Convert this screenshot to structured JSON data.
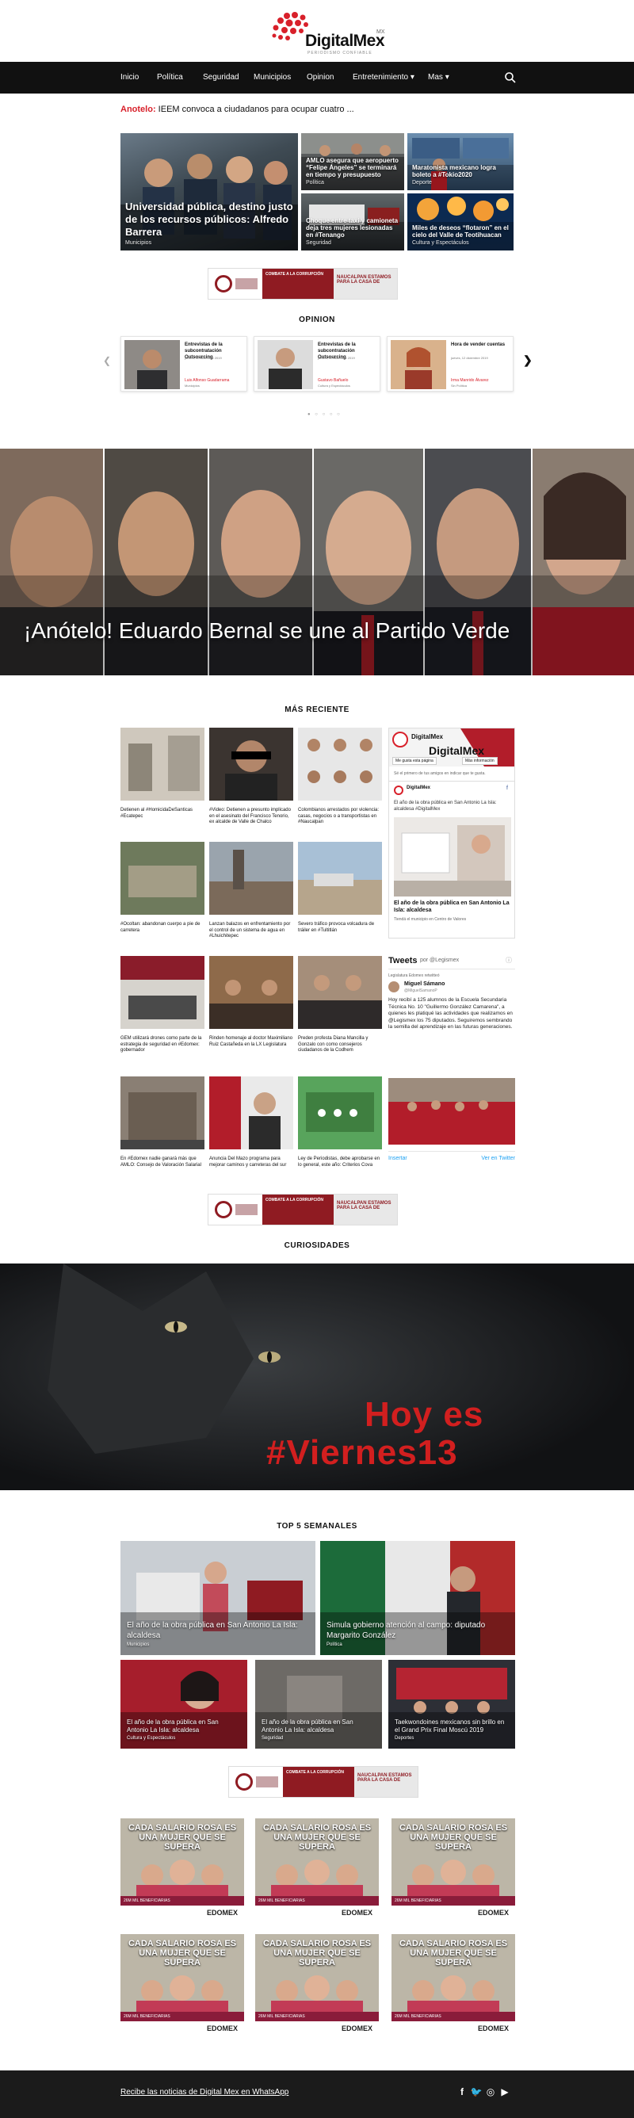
{
  "brand": {
    "name": "DigitalMex",
    "suffix": "MX",
    "tagline": "PERIODISMO CONFIABLE"
  },
  "nav": {
    "items": [
      "Inicio",
      "Política",
      "Seguridad",
      "Municipios",
      "Opinion",
      "Entretenimiento",
      "Mas"
    ]
  },
  "ticker": {
    "label": "Anotelo:",
    "text": "IEEM convoca a ciudadanos para ocupar cuatro ..."
  },
  "hero": {
    "main": {
      "title": "Universidad pública, destino justo de los recursos públicos: Alfredo Barrera",
      "category": "Municipios"
    },
    "tiles": [
      {
        "title": "AMLO asegura que aeropuerto “Felipe Ángeles” se terminará en tiempo y presupuesto",
        "category": "Política"
      },
      {
        "title": "Maratonista mexicano logra boleto a #Tokio2020",
        "category": "Deporte"
      },
      {
        "title": "Choque entre taxi y camioneta deja tres mujeres lesionadas en #Tenango",
        "category": "Seguridad"
      },
      {
        "title": "Miles de deseos “flotaron” en el cielo del Valle de Teotihuacan",
        "category": "Cultura y Espectáculos"
      }
    ]
  },
  "ad": {
    "text1": "COMBATE A LA CORRUPCIÓN",
    "text2": "NAUCALPAN ESTAMOS PARA LA CASA DE"
  },
  "sections": {
    "opinion": "OPINION",
    "recent": "MÁS RECIENTE",
    "curiosities": "CURIOSIDADES",
    "top5": "TOP 5 SEMANALES"
  },
  "opinion_cards": [
    {
      "title": "Entrevistas de la subcontratación Outsourcing",
      "date": "jueves, 12 diciembre 2019",
      "author": "Luis Alfonso Guadarrama",
      "category": "Municipios"
    },
    {
      "title": "Entrevistas de la subcontratación Outsourcing",
      "date": "jueves, 12 diciembre 2019",
      "author": "Gustavo Bañuelo",
      "category": "Cultura y Espectáculos"
    },
    {
      "title": "Hora de vender cuentas",
      "date": "jueves, 12 diciembre 2019",
      "author": "Irma Manrido Álvarez",
      "category": "Sin Política"
    }
  ],
  "carousel_dots": "● ○ ○ ○ ○",
  "feature": {
    "title": "¡Anótelo! Eduardo Bernal se une al Partido Verde"
  },
  "recent": [
    {
      "title": "Detienen al #HomicidaDeSanticas #Ecatepec"
    },
    {
      "title": "#Video: Detienen a presunto implicado en el asesinato del Francisco Tenorio, ex alcalde de Valle de Chalco"
    },
    {
      "title": "Colombianos arrestados por violencia: casas, negocios o a transportistas en #Naucalpan"
    },
    {
      "title": "#Ocoltan: abandonan cuerpo a pie de carretera"
    },
    {
      "title": "Lanzan balazos en enfrentamiento por el control de un sistema de agua en #Lhuichitepec"
    },
    {
      "title": "Severo tráfico provoca volcadura de tráiler en #Tultitlán"
    },
    {
      "title": "GEM utilizará drones como parte de la estrategia de seguridad en #Edomex: gobernador"
    },
    {
      "title": "Rinden homenaje al doctor Maximiliano Ruiz Castañeda en la LX Legislatura"
    },
    {
      "title": "Preden profesta Diana Mancilla y Gonzalo con como consejeros ciudadanos de la Codhem"
    },
    {
      "title": "En #Edomex nadie ganará más que AMLO: Consejo de Valoración Salarial"
    },
    {
      "title": "Anuncia Del Mazo programa para mejorar caminos y carreteras del sur"
    },
    {
      "title": "Ley de Periodistas, debe aprobarse en lo general, este año: Criterios Cova"
    }
  ],
  "fb_widget": {
    "page_name": "DigitalMex",
    "likes": "Me gusta esta página",
    "info": "Más información",
    "first": "Sé el primero de tus amigos en indicar que te gusta.",
    "post_author": "DigitalMex",
    "post_text": "El año de la obra pública en San Antonio La Isla: alcaldesa #DigitalMex",
    "link_title": "El año de la obra pública en San Antonio La Isla: alcaldesa",
    "link_sub": "Tiendá el municipio en Centro de Valores"
  },
  "tw_widget": {
    "title": "Tweets",
    "by": "por @Legismex",
    "retweet": "Legislatura Edomex retwitteó",
    "user": "Miguel Sámano",
    "handle": "@MiguelSamanoP",
    "text": "Hoy recibí a 125 alumnos de la Escuela Secundaria Técnica No. 10 \"Guillermo González Camarena\", a quienes les platiqué las actividades que realizamos en @Legismex los 75 diputados. Seguiremos sembrando la semilla del aprendizaje en las futuras generaciones.",
    "embed": "Insertar",
    "view": "Ver en Twitter"
  },
  "curiosity": {
    "line1": "Hoy es",
    "line2": "#Viernes13"
  },
  "top5": [
    {
      "title": "El año de la obra pública en San Antonio La Isla: alcaldesa",
      "category": "Municipios"
    },
    {
      "title": "Simula gobierno atención al campo: diputado Margarito González",
      "category": "Política"
    },
    {
      "title": "El año de la obra pública en San Antonio La Isla: alcaldesa",
      "category": "Cultura y Espectáculos"
    },
    {
      "title": "El año de la obra pública en San Antonio La Isla: alcaldesa",
      "category": "Seguridad"
    },
    {
      "title": "Taekwondoines mexicanos sin brillo en el Grand Prix Final Moscú 2019",
      "category": "Deportes"
    }
  ],
  "salario_rosa": {
    "headline": "CADA SALARIO ROSA ES UNA MUJER QUE SE SUPERA",
    "band": "26M MIL BENEFICIARIAS",
    "logo": "EDOMEX"
  },
  "footer": {
    "text": "Recibe las noticias de Digital Mex en WhatsApp",
    "social": [
      "facebook-icon",
      "twitter-icon",
      "instagram-icon",
      "youtube-icon"
    ]
  },
  "colors": {
    "accent": "#d8202a",
    "nav_bg": "#111111",
    "footer_bg": "#1b1b1b",
    "ad_red": "#8f1b22",
    "curiosity_red": "#d21f1f"
  }
}
